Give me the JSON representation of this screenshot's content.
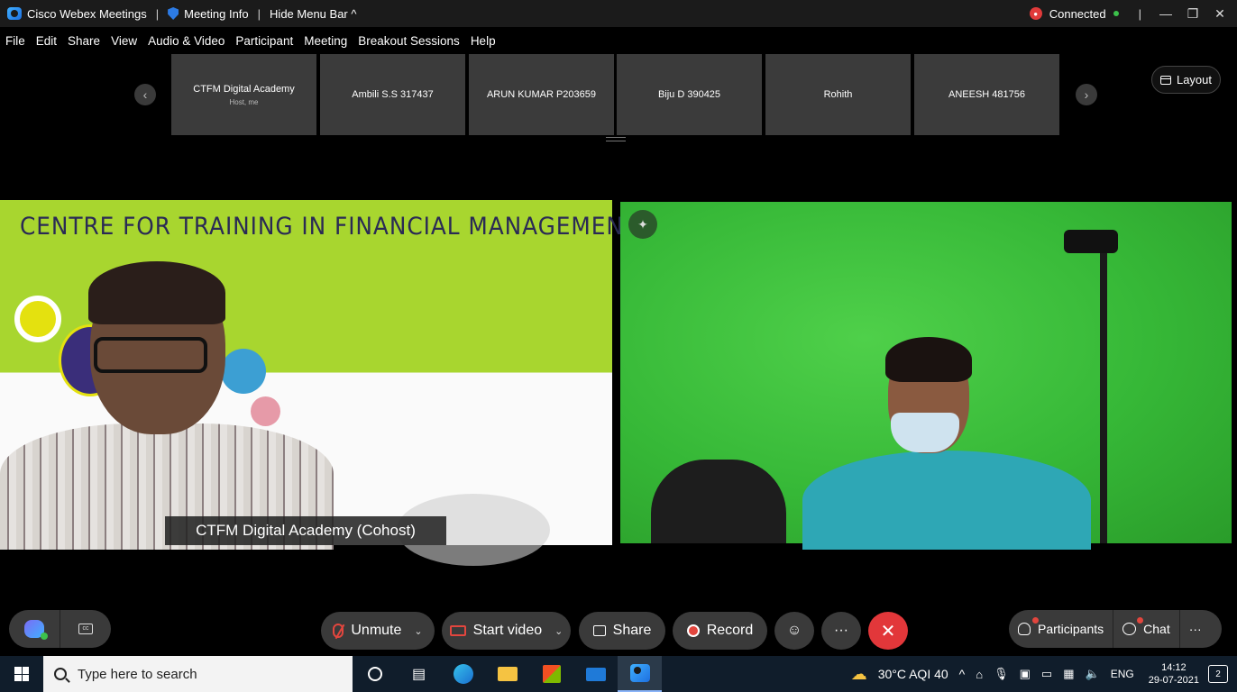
{
  "titlebar": {
    "app_name": "Cisco Webex Meetings",
    "meeting_info": "Meeting Info",
    "hide_menu": "Hide Menu Bar ^",
    "status": "Connected"
  },
  "menu": [
    "File",
    "Edit",
    "Share",
    "View",
    "Audio & Video",
    "Participant",
    "Meeting",
    "Breakout Sessions",
    "Help"
  ],
  "participants_strip": [
    {
      "name": "CTFM Digital Academy",
      "sub": "Host, me"
    },
    {
      "name": "Ambili S.S 317437",
      "sub": ""
    },
    {
      "name": "ARUN KUMAR P203659",
      "sub": ""
    },
    {
      "name": "Biju D 390425",
      "sub": ""
    },
    {
      "name": "Rohith",
      "sub": ""
    },
    {
      "name": "ANEESH 481756",
      "sub": ""
    }
  ],
  "layout_button": "Layout",
  "video_left": {
    "banner": "CENTRE FOR TRAINING IN FINANCIAL MANAGEMENT",
    "name_label": "CTFM Digital Academy (Cohost)"
  },
  "controls": {
    "unmute": "Unmute",
    "start_video": "Start video",
    "share": "Share",
    "record": "Record",
    "more": "···",
    "participants": "Participants",
    "chat": "Chat",
    "right_more": "···"
  },
  "taskbar": {
    "search_placeholder": "Type here to search",
    "weather": "30°C  AQI 40",
    "language": "ENG",
    "time": "14:12",
    "date": "29-07-2021",
    "notifications": "2"
  },
  "colors": {
    "end_call": "#e2373a",
    "control_bg": "#3a3a3a",
    "taskbar_bg": "#101d2b"
  }
}
